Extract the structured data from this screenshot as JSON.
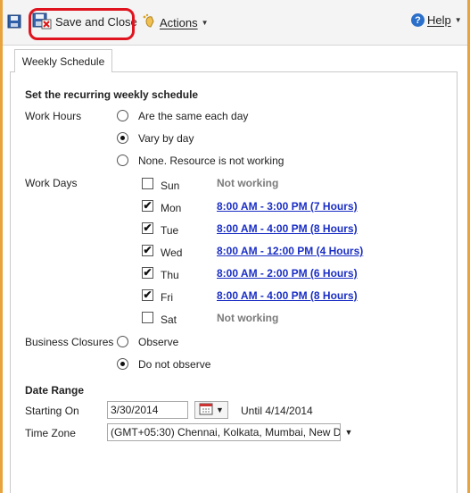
{
  "toolbar": {
    "save_close_label": "Save and Close",
    "actions_label": "Actions",
    "help_label": "Help"
  },
  "tab": {
    "label": "Weekly Schedule"
  },
  "schedule": {
    "heading": "Set the recurring weekly schedule",
    "work_hours_label": "Work Hours",
    "work_hours_options": [
      {
        "label": "Are the same each day",
        "selected": false
      },
      {
        "label": "Vary by day",
        "selected": true
      },
      {
        "label": "None. Resource is not working",
        "selected": false
      }
    ],
    "work_days_label": "Work Days",
    "days": [
      {
        "day": "Sun",
        "checked": false,
        "hours": "Not working"
      },
      {
        "day": "Mon",
        "checked": true,
        "hours": "8:00 AM - 3:00 PM (7 Hours)"
      },
      {
        "day": "Tue",
        "checked": true,
        "hours": "8:00 AM - 4:00 PM (8 Hours)"
      },
      {
        "day": "Wed",
        "checked": true,
        "hours": "8:00 AM - 12:00 PM (4 Hours)"
      },
      {
        "day": "Thu",
        "checked": true,
        "hours": "8:00 AM - 2:00 PM (6 Hours)"
      },
      {
        "day": "Fri",
        "checked": true,
        "hours": "8:00 AM - 4:00 PM (8 Hours)"
      },
      {
        "day": "Sat",
        "checked": false,
        "hours": "Not working"
      }
    ],
    "business_closures_label": "Business Closures",
    "closure_options": [
      {
        "label": "Observe",
        "selected": false
      },
      {
        "label": "Do not observe",
        "selected": true
      }
    ]
  },
  "date_range": {
    "heading": "Date Range",
    "starting_on_label": "Starting On",
    "starting_on_value": "3/30/2014",
    "until_text": "Until 4/14/2014",
    "time_zone_label": "Time Zone",
    "time_zone_value": "(GMT+05:30) Chennai, Kolkata, Mumbai, New D"
  },
  "colors": {
    "frame": "#e8a33c",
    "highlight": "#e0141e",
    "link": "#1a2ec4"
  }
}
